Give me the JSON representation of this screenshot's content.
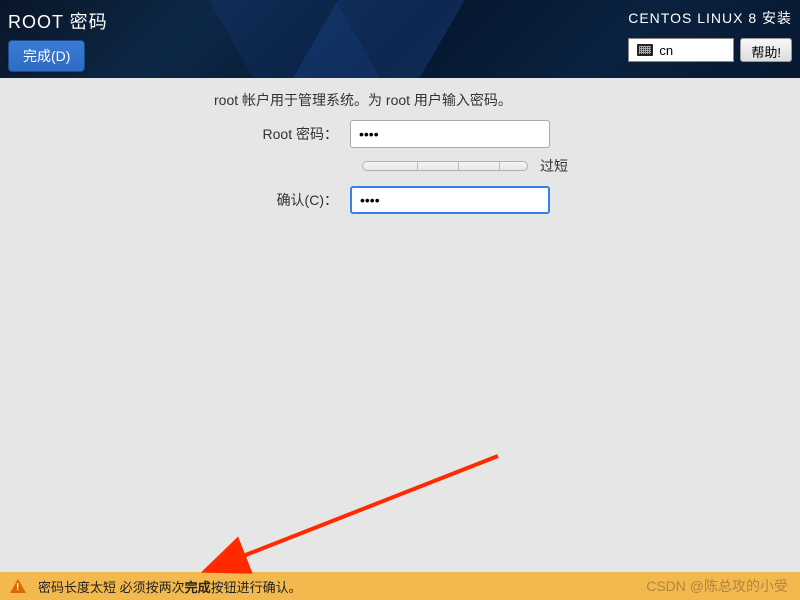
{
  "header": {
    "title": "ROOT 密码",
    "done_button": "完成(D)",
    "installer_title": "CENTOS LINUX 8 安装",
    "keyboard_layout": "cn",
    "help_button": "帮助!"
  },
  "form": {
    "instruction": "root 帐户用于管理系统。为 root 用户输入密码。",
    "password_label": "Root 密码：",
    "password_value": "••••",
    "strength_text": "过短",
    "confirm_label": "确认(C)：",
    "confirm_value": "••••"
  },
  "warning": {
    "text_prefix": "密码长度太短 必须按两次",
    "bold": "完成",
    "text_suffix": "按钮进行确认。"
  },
  "watermark": "CSDN @陈总攻的小受"
}
